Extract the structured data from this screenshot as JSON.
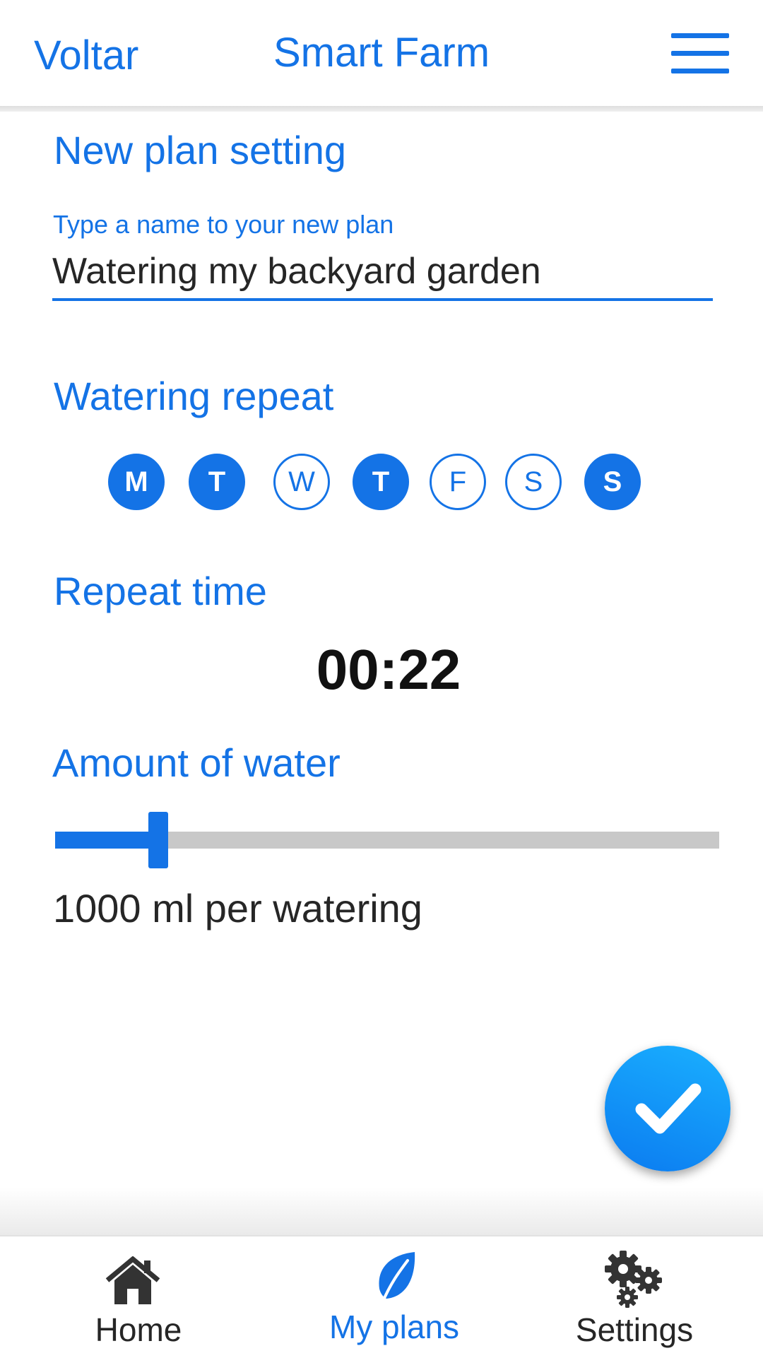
{
  "header": {
    "back_label": "Voltar",
    "title": "Smart Farm",
    "menu_icon": "hamburger-menu-icon"
  },
  "form": {
    "section_title": "New plan setting",
    "name_label": "Type a name to your new plan",
    "name_value": "Watering my backyard garden"
  },
  "watering_repeat": {
    "title": "Watering repeat",
    "days": [
      {
        "label": "M",
        "selected": true
      },
      {
        "label": "T",
        "selected": true
      },
      {
        "label": "W",
        "selected": false
      },
      {
        "label": "T",
        "selected": true
      },
      {
        "label": "F",
        "selected": false
      },
      {
        "label": "S",
        "selected": false
      },
      {
        "label": "S",
        "selected": true
      }
    ]
  },
  "repeat_time": {
    "title": "Repeat time",
    "value": "00:22"
  },
  "water_amount": {
    "title": "Amount of water",
    "slider_fraction": 0.155,
    "value_text": "1000 ml per watering"
  },
  "fab": {
    "icon": "checkmark-icon"
  },
  "bottom_nav": {
    "items": [
      {
        "label": "Home",
        "icon": "home-icon",
        "active": false
      },
      {
        "label": "My plans",
        "icon": "leaf-icon",
        "active": true
      },
      {
        "label": "Settings",
        "icon": "gears-icon",
        "active": false
      }
    ]
  },
  "colors": {
    "accent": "#1473e6",
    "text_dark": "#262626",
    "inactive_icon": "#333333",
    "track": "#c8c8c8"
  }
}
